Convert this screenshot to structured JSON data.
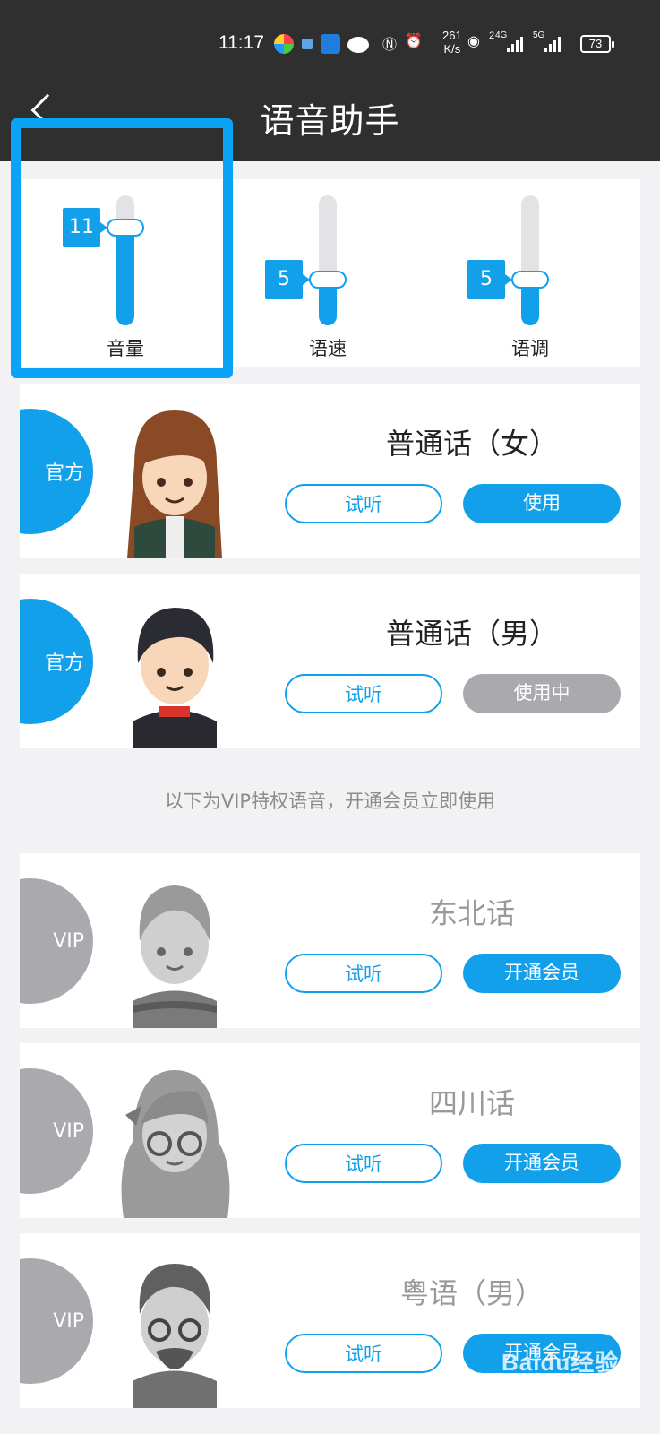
{
  "status_bar": {
    "time": "11:17",
    "net_speed_value": "261",
    "net_speed_unit": "K/s",
    "mobile_1": "2",
    "mobile_1_tech": "4G",
    "mobile_2_tech": "5G",
    "battery": "73"
  },
  "header": {
    "title": "语音助手"
  },
  "sliders": [
    {
      "label": "音量",
      "value": "11",
      "level": 0.75
    },
    {
      "label": "语速",
      "value": "5",
      "level": 0.35
    },
    {
      "label": "语调",
      "value": "5",
      "level": 0.35
    }
  ],
  "voices": [
    {
      "badge": "官方",
      "name": "普通话（女）",
      "preview": "试听",
      "action": "使用"
    },
    {
      "badge": "官方",
      "name": "普通话（男）",
      "preview": "试听",
      "action": "使用中"
    }
  ],
  "vip_note": "以下为VIP特权语音，开通会员立即使用",
  "vip_voices": [
    {
      "badge": "VIP",
      "name": "东北话",
      "preview": "试听",
      "action": "开通会员"
    },
    {
      "badge": "VIP",
      "name": "四川话",
      "preview": "试听",
      "action": "开通会员"
    },
    {
      "badge": "VIP",
      "name": "粤语（男）",
      "preview": "试听",
      "action": "开通会员"
    }
  ],
  "colors": {
    "accent": "#12a0eb",
    "header_bg": "#2f2f2f",
    "muted": "#a9a9ae",
    "highlight": "#0aa3f5"
  },
  "watermark": "Baidu经验"
}
